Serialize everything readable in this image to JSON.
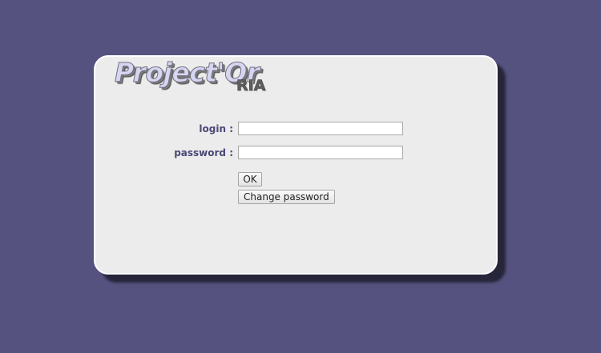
{
  "logo": {
    "main_text": "Project'Or",
    "sub_text": "RIA"
  },
  "login_form": {
    "login_label": "login :",
    "login_value": "",
    "password_label": "password :",
    "password_value": "",
    "ok_label": "OK",
    "change_password_label": "Change password"
  },
  "colors": {
    "background": "#55527f",
    "panel": "#ececec",
    "label_text": "#4a4876"
  }
}
